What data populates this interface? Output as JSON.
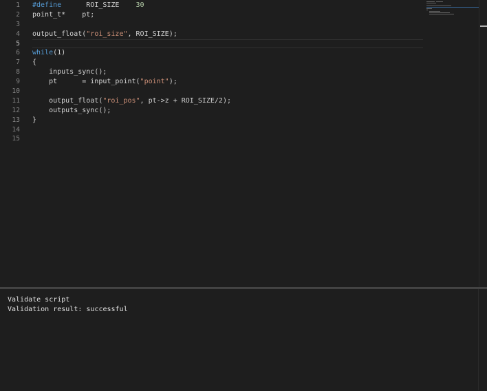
{
  "editor": {
    "line_numbers": [
      "1",
      "2",
      "3",
      "4",
      "5",
      "6",
      "7",
      "8",
      "9",
      "10",
      "11",
      "12",
      "13",
      "14",
      "15"
    ],
    "lines": [
      {
        "parts": [
          [
            "kw",
            "#define"
          ],
          [
            "plain",
            "      ROI_SIZE    "
          ],
          [
            "num",
            "30"
          ]
        ]
      },
      {
        "parts": [
          [
            "plain",
            "point_t*    pt;"
          ]
        ]
      },
      {
        "parts": []
      },
      {
        "parts": [
          [
            "plain",
            "output_float("
          ],
          [
            "str",
            "\"roi_size\""
          ],
          [
            "plain",
            ", ROI_SIZE);"
          ]
        ]
      },
      {
        "parts": []
      },
      {
        "parts": [
          [
            "kw",
            "while"
          ],
          [
            "plain",
            "(1)"
          ]
        ]
      },
      {
        "parts": [
          [
            "plain",
            "{"
          ]
        ]
      },
      {
        "parts": [
          [
            "plain",
            "    inputs_sync();"
          ]
        ]
      },
      {
        "parts": [
          [
            "plain",
            "    pt      = input_point("
          ],
          [
            "str",
            "\"point\""
          ],
          [
            "plain",
            ");"
          ]
        ]
      },
      {
        "parts": []
      },
      {
        "parts": [
          [
            "plain",
            "    output_float("
          ],
          [
            "str",
            "\"roi_pos\""
          ],
          [
            "plain",
            ", pt->z + ROI_SIZE/2);"
          ]
        ]
      },
      {
        "parts": [
          [
            "plain",
            "    outputs_sync();"
          ]
        ]
      },
      {
        "parts": [
          [
            "plain",
            "}"
          ]
        ]
      },
      {
        "parts": []
      },
      {
        "parts": []
      }
    ]
  },
  "output": {
    "lines": [
      "Validate script",
      "Validation result: successful"
    ]
  }
}
